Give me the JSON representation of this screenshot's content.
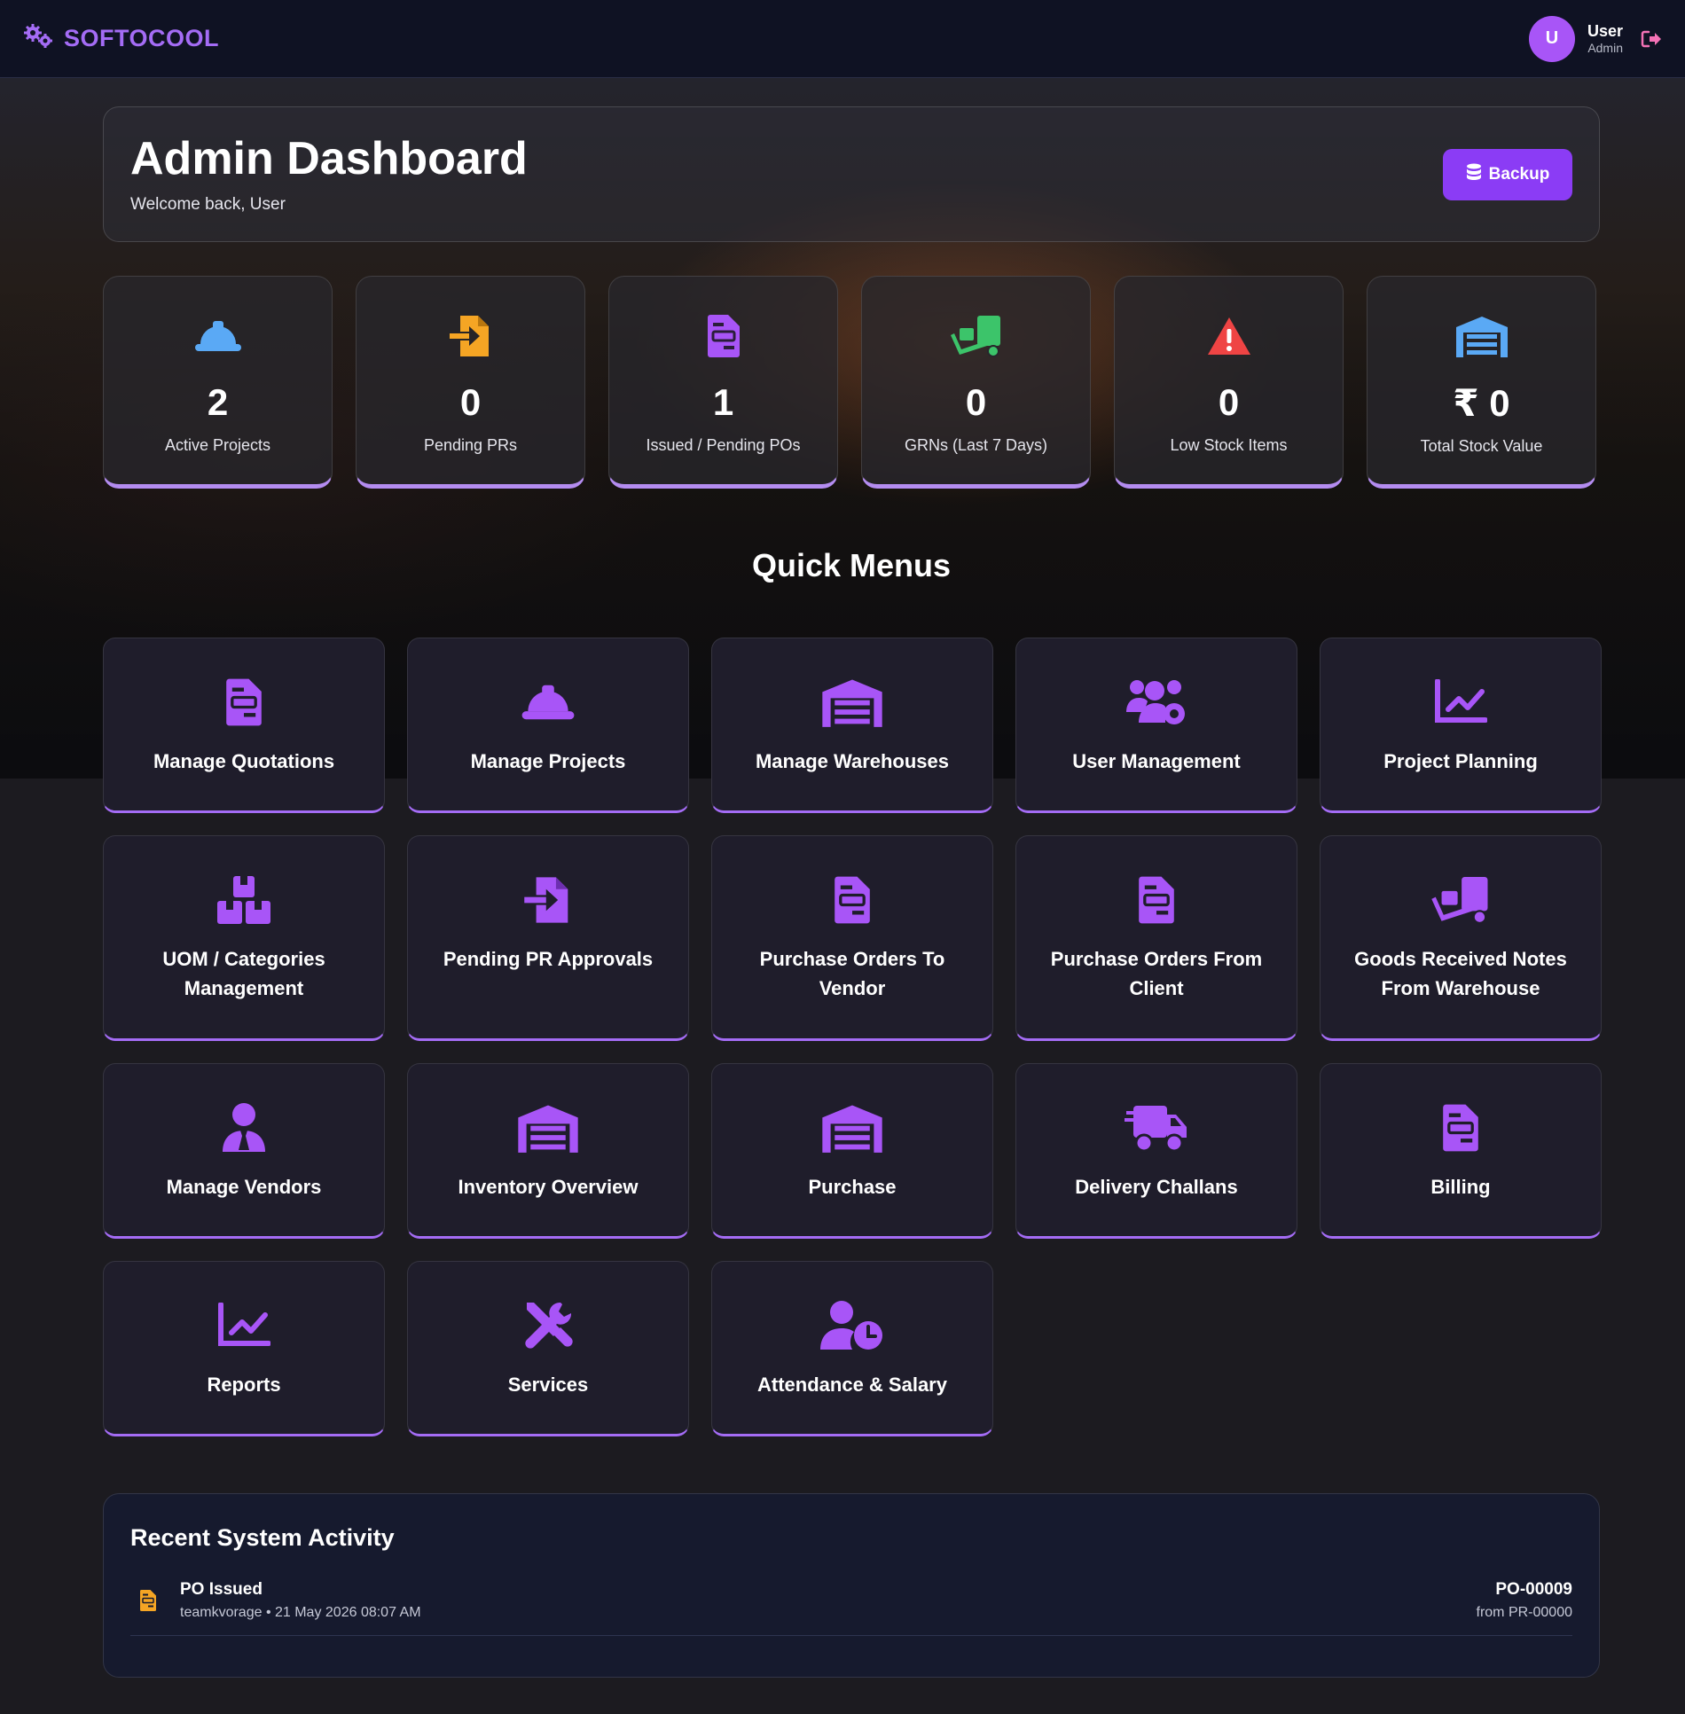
{
  "brand": {
    "name": "SOFTOCOOL",
    "icon": "gears-icon",
    "color": "#a46cf5"
  },
  "user": {
    "initial": "U",
    "name": "User",
    "role": "Admin",
    "logout_icon": "logout-icon"
  },
  "header": {
    "title": "Admin Dashboard",
    "welcome": "Welcome back, User",
    "backup_label": "Backup",
    "backup_icon": "database-icon"
  },
  "stats": [
    {
      "value": "2",
      "label": "Active Projects",
      "icon": "hard-hat-icon",
      "color": "#5aa9f5"
    },
    {
      "value": "0",
      "label": "Pending PRs",
      "icon": "file-import-icon",
      "color": "#f5a524"
    },
    {
      "value": "1",
      "label": "Issued / Pending POs",
      "icon": "file-invoice-icon",
      "color": "#a46cf5"
    },
    {
      "value": "0",
      "label": "GRNs (Last 7 Days)",
      "icon": "dolly-icon",
      "color": "#3cc46a"
    },
    {
      "value": "0",
      "label": "Low Stock Items",
      "icon": "warning-icon",
      "color": "#ef4444"
    },
    {
      "value": "₹ 0",
      "label": "Total Stock Value",
      "icon": "warehouse-icon",
      "color": "#5aa9f5"
    }
  ],
  "quick_menus": {
    "title": "Quick Menus",
    "items": [
      {
        "label": "Manage Quotations",
        "icon": "file-invoice-icon"
      },
      {
        "label": "Manage Projects",
        "icon": "hard-hat-icon"
      },
      {
        "label": "Manage Warehouses",
        "icon": "warehouse-icon"
      },
      {
        "label": "User Management",
        "icon": "users-cog-icon"
      },
      {
        "label": "Project Planning",
        "icon": "chart-line-icon"
      },
      {
        "label": "UOM / Categories Management",
        "icon": "boxes-icon"
      },
      {
        "label": "Pending PR Approvals",
        "icon": "file-import-icon"
      },
      {
        "label": "Purchase Orders To Vendor",
        "icon": "file-invoice-icon"
      },
      {
        "label": "Purchase Orders From Client",
        "icon": "file-invoice-icon"
      },
      {
        "label": "Goods Received Notes From Warehouse",
        "icon": "dolly-icon"
      },
      {
        "label": "Manage Vendors",
        "icon": "user-tie-icon"
      },
      {
        "label": "Inventory Overview",
        "icon": "warehouse-icon"
      },
      {
        "label": "Purchase",
        "icon": "warehouse-icon"
      },
      {
        "label": "Delivery Challans",
        "icon": "truck-fast-icon"
      },
      {
        "label": "Billing",
        "icon": "file-invoice-icon"
      },
      {
        "label": "Reports",
        "icon": "chart-line-icon"
      },
      {
        "label": "Services",
        "icon": "tools-icon"
      },
      {
        "label": "Attendance & Salary",
        "icon": "user-clock-icon"
      }
    ]
  },
  "activity": {
    "title": "Recent System Activity",
    "items": [
      {
        "title": "PO Issued",
        "meta": "teamkvorage • 21 May 2026 08:07 AM",
        "ref": "PO-00009",
        "from": "from PR-00000",
        "icon": "file-invoice-icon",
        "color": "#f5a524"
      }
    ]
  },
  "colors": {
    "accent": "#a855f7",
    "button": "#8b3cf5",
    "menu_icon": "#a855f7"
  }
}
